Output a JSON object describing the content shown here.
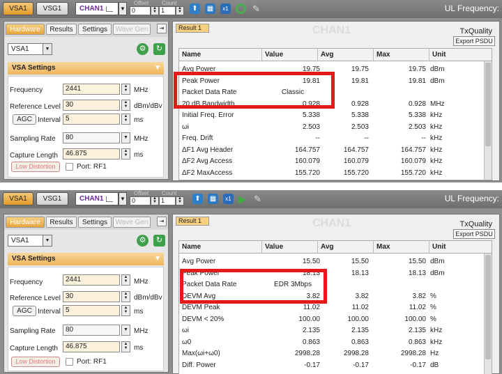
{
  "panels": [
    {
      "toolbar": {
        "tab_vsa": "VSA1",
        "tab_vsg": "VSG1",
        "chan": "CHAN1",
        "offset_label": "Offset",
        "offset_value": "0",
        "count_label": "Count",
        "count_value": "1",
        "ul_frequency": "UL Frequency:"
      },
      "left": {
        "tabs": [
          "Hardware",
          "Results",
          "Settings",
          "Wave Gen"
        ],
        "analyzer": "VSA1",
        "section": "VSA Settings",
        "frequency_label": "Frequency",
        "frequency_value": "2441",
        "frequency_unit": "MHz",
        "ref_label": "Reference Level",
        "ref_value": "30",
        "ref_unit": "dBm/dBv",
        "agc": "AGC",
        "interval_label": "Interval",
        "interval_value": "5",
        "interval_unit": "ms",
        "sampling_label": "Sampling Rate",
        "sampling_value": "80",
        "sampling_unit": "MHz",
        "capture_label": "Capture Length",
        "capture_value": "46.875",
        "capture_unit": "ms",
        "low_distortion": "Low Distortion",
        "port": "Port: RF1"
      },
      "right": {
        "tab": "Result 1",
        "watermark": "CHAN1",
        "title": "TxQuality",
        "export": "Export PSDU",
        "columns": [
          "Name",
          "Value",
          "Avg",
          "Max",
          "Unit"
        ],
        "rows": [
          [
            "Avg Power",
            "19.75",
            "19.75",
            "19.75",
            "dBm"
          ],
          [
            "Peak Power",
            "19.81",
            "19.81",
            "19.81",
            "dBm"
          ],
          [
            "Packet Data Rate",
            "Classic",
            "",
            "",
            ""
          ],
          [
            "20 dB Bandwidth",
            "0.928",
            "0.928",
            "0.928",
            "MHz"
          ],
          [
            "Initial Freq. Error",
            "5.338",
            "5.338",
            "5.338",
            "kHz"
          ],
          [
            "ωi",
            "2.503",
            "2.503",
            "2.503",
            "kHz"
          ],
          [
            "Freq. Drift",
            "--",
            "--",
            "--",
            "kHz"
          ],
          [
            "ΔF1 Avg Header",
            "164.757",
            "164.757",
            "164.757",
            "kHz"
          ],
          [
            "ΔF2 Avg Access",
            "160.079",
            "160.079",
            "160.079",
            "kHz"
          ],
          [
            "ΔF2 MaxAccess",
            "155.720",
            "155.720",
            "155.720",
            "kHz"
          ]
        ]
      }
    },
    {
      "toolbar": {
        "tab_vsa": "VSA1",
        "tab_vsg": "VSG1",
        "chan": "CHAN1",
        "offset_label": "Offset",
        "offset_value": "0",
        "count_label": "Count",
        "count_value": "1",
        "ul_frequency": "UL Frequency:"
      },
      "left": {
        "tabs": [
          "Hardware",
          "Results",
          "Settings",
          "Wave Gen"
        ],
        "analyzer": "VSA1",
        "section": "VSA Settings",
        "frequency_label": "Frequency",
        "frequency_value": "2441",
        "frequency_unit": "MHz",
        "ref_label": "Reference Level",
        "ref_value": "30",
        "ref_unit": "dBm/dBv",
        "agc": "AGC",
        "interval_label": "Interval",
        "interval_value": "5",
        "interval_unit": "ms",
        "sampling_label": "Sampling Rate",
        "sampling_value": "80",
        "sampling_unit": "MHz",
        "capture_label": "Capture Length",
        "capture_value": "46.875",
        "capture_unit": "ms",
        "low_distortion": "Low Distortion",
        "port": "Port: RF1"
      },
      "right": {
        "tab": "Result 1",
        "watermark": "CHAN1",
        "title": "TxQuality",
        "export": "Export PSDU",
        "columns": [
          "Name",
          "Value",
          "Avg",
          "Max",
          "Unit"
        ],
        "rows": [
          [
            "Avg Power",
            "15.50",
            "15.50",
            "15.50",
            "dBm"
          ],
          [
            "Peak Power",
            "18.13",
            "18.13",
            "18.13",
            "dBm"
          ],
          [
            "Packet Data Rate",
            "EDR 3Mbps",
            "",
            "",
            ""
          ],
          [
            "DEVM Avg",
            "3.82",
            "3.82",
            "3.82",
            "%"
          ],
          [
            "DEVM Peak",
            "11.02",
            "11.02",
            "11.02",
            "%"
          ],
          [
            "DEVM < 20%",
            "100.00",
            "100.00",
            "100.00",
            "%"
          ],
          [
            "ωi",
            "2.135",
            "2.135",
            "2.135",
            "kHz"
          ],
          [
            "ω0",
            "0.863",
            "0.863",
            "0.863",
            "kHz"
          ],
          [
            "Max(ωi+ω0)",
            "2998.28",
            "2998.28",
            "2998.28",
            "Hz"
          ],
          [
            "Diff. Power",
            "-0.17",
            "-0.17",
            "-0.17",
            "dB"
          ]
        ]
      }
    }
  ]
}
